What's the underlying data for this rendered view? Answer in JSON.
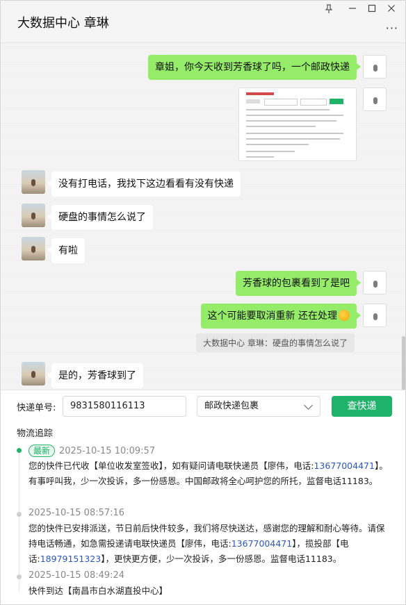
{
  "window": {
    "title": "大数据中心 章琳",
    "controls": {
      "pin": "pin-icon",
      "minimize": "minimize-icon",
      "maximize": "maximize-icon",
      "close": "close-icon",
      "more": "more-icon"
    }
  },
  "messages": [
    {
      "side": "me",
      "text": "章姐，你今天收到芳香球了吗，一个邮政快递"
    },
    {
      "side": "me",
      "type": "image"
    },
    {
      "side": "other",
      "text": "没有打电话，我找下这边看看有没有快递"
    },
    {
      "side": "other",
      "text": "硬盘的事情怎么说了"
    },
    {
      "side": "other",
      "text": "有啦"
    },
    {
      "side": "me",
      "text": "芳香球的包裹看到了是吧"
    },
    {
      "side": "me",
      "text": "这个可能要取消重新  还在处理"
    },
    {
      "side": "quote",
      "text": "大数据中心 章琳：硬盘的事情怎么说了"
    },
    {
      "side": "other",
      "text": "是的，芳香球到了"
    }
  ],
  "tracking": {
    "number_label": "快递单号:",
    "number_value": "9831580116113",
    "carrier_selected": "邮政快递包裹",
    "search_button": "查快递",
    "section_title": "物流追踪",
    "events": [
      {
        "badge": "最新",
        "time": "2025-10-15 10:09:57",
        "text_parts": [
          "您的快件已代收【单位收发室签收】，如有疑问请电联快递员【廖伟，电话:",
          "13677004471",
          "】。有事呼叫我，少一次投诉，多一份感恩。中国邮政将全心呵护您的所托，监督电话11183。"
        ]
      },
      {
        "time": "2025-10-15 08:57:16",
        "text_parts": [
          "您的快件已安排派送，节日前后快件较多，我们将尽快送达，感谢您的理解和耐心等待。请保持电话畅通，如急需投递请电联快递员【廖伟，电话:",
          "13677004471",
          "】，揽投部【电话:",
          "18979151323",
          "】，更快更方便，少一次投诉，多一份感恩。监督电话11183。"
        ]
      },
      {
        "time": "2025-10-15 08:49:24",
        "text": "快件到达【南昌市白水湖直投中心】"
      }
    ]
  }
}
